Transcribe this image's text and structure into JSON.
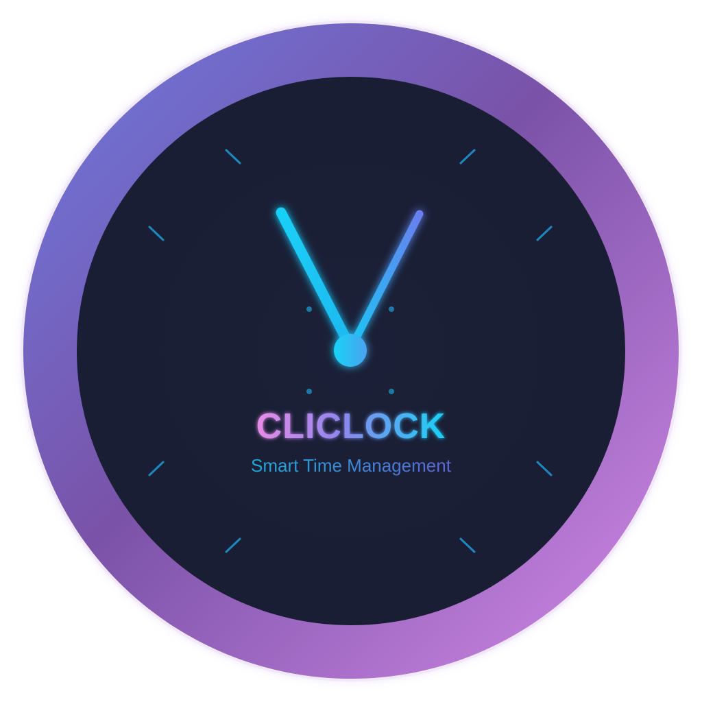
{
  "brand": {
    "name": "CLICLOCK",
    "tagline": "Smart Time Management"
  },
  "icons": {
    "logo": "clock-logo-icon",
    "hour_hand": "clock-hand-icon",
    "minute_hand": "clock-hand-icon"
  },
  "colors": {
    "ring_start": "#6a6fd6",
    "ring_mid": "#7b4fa8",
    "ring_end": "#cf86e6",
    "face": "#1a1f36",
    "hand_cyan": "#16c7f2",
    "hand_blue": "#5b7cf0",
    "tick": "#1c8bbd",
    "text_pink": "#e58ce8",
    "text_cyan": "#1fd0f5",
    "tagline_start": "#2aa6d6",
    "tagline_end": "#5a6ad8"
  }
}
